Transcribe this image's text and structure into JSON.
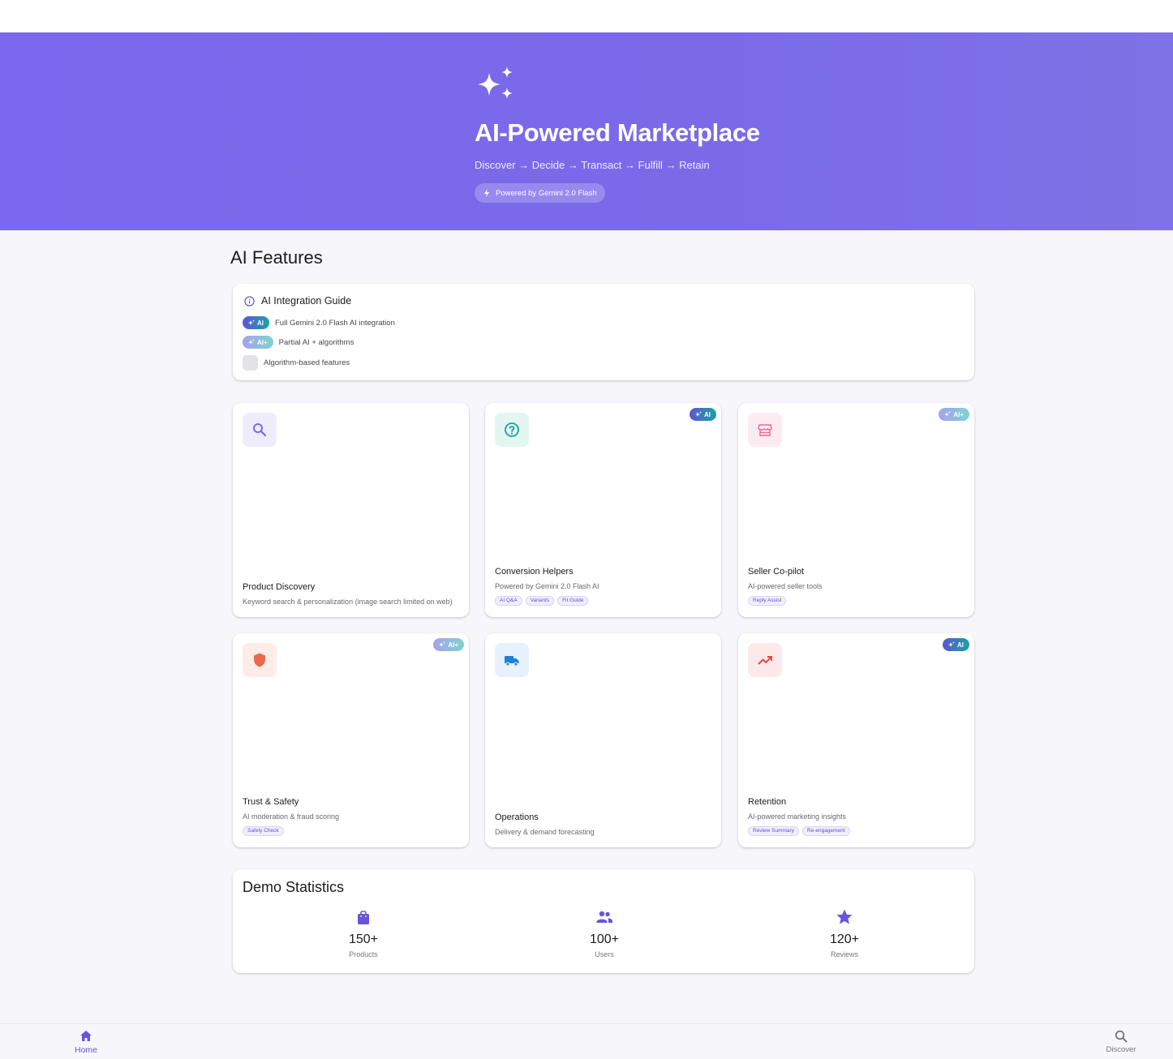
{
  "hero": {
    "title": "AI-Powered Marketplace",
    "subtitle": "Discover → Decide → Transact → Fulfill → Retain",
    "chip": "Powered by Gemini 2.0 Flash"
  },
  "section_title": "AI Features",
  "guide": {
    "title": "AI Integration Guide",
    "rows": [
      {
        "badge": "AI",
        "label": "Full Gemini 2.0 Flash AI integration"
      },
      {
        "badge": "AI+",
        "label": "Partial AI + algorithms"
      },
      {
        "badge": "",
        "label": "Algorithm-based features"
      }
    ]
  },
  "features": [
    {
      "title": "Product Discovery",
      "desc": "Keyword search & personalization (image search limited on web)",
      "badge": "",
      "tags": [],
      "icon": "search-icon",
      "color": "#7b68ee"
    },
    {
      "title": "Conversion Helpers",
      "desc": "Powered by Gemini 2.0 Flash AI",
      "badge": "AI",
      "tags": [
        "AI Q&A",
        "Variants",
        "Fit Guide"
      ],
      "icon": "help-circle-icon",
      "color": "#12a594"
    },
    {
      "title": "Seller Co-pilot",
      "desc": "AI-powered seller tools",
      "badge": "AI+",
      "tags": [
        "Reply Assist"
      ],
      "icon": "storefront-icon",
      "color": "#e86a9a"
    },
    {
      "title": "Trust & Safety",
      "desc": "AI moderation & fraud scoring",
      "badge": "AI+",
      "tags": [
        "Safety Check"
      ],
      "icon": "shield-icon",
      "color": "#e86a4a"
    },
    {
      "title": "Operations",
      "desc": "Delivery & demand forecasting",
      "badge": "",
      "tags": [],
      "icon": "truck-icon",
      "color": "#1e7fd8"
    },
    {
      "title": "Retention",
      "desc": "AI-powered marketing insights",
      "badge": "AI",
      "tags": [
        "Review Summary",
        "Re-engagement"
      ],
      "icon": "trending-up-icon",
      "color": "#e0474c"
    }
  ],
  "stats": {
    "title": "Demo Statistics",
    "items": [
      {
        "value": "150+",
        "label": "Products",
        "icon": "shopping-bag-icon"
      },
      {
        "value": "100+",
        "label": "Users",
        "icon": "people-icon"
      },
      {
        "value": "120+",
        "label": "Reviews",
        "icon": "star-icon"
      }
    ]
  },
  "nav": {
    "home": "Home",
    "discover": "Discover"
  },
  "colors": {
    "accent": "#7b68ee",
    "hero_bg": "#7a6ae8"
  }
}
